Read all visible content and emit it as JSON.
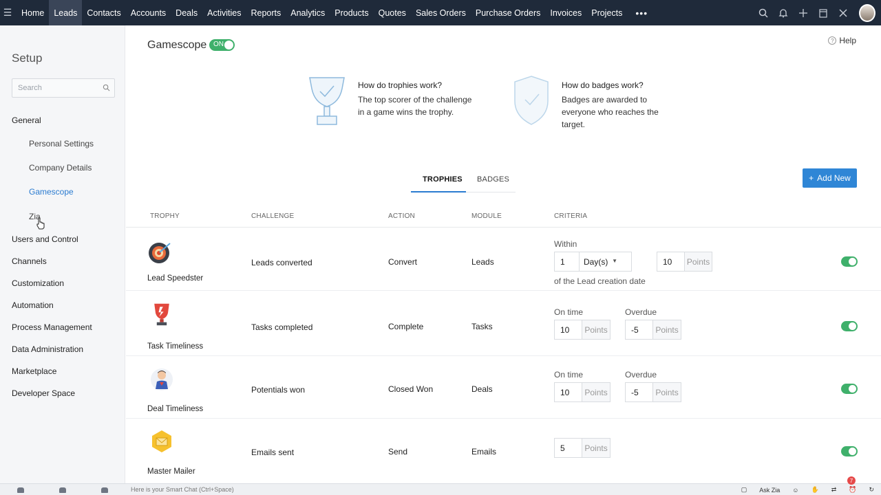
{
  "nav": {
    "items": [
      "Home",
      "Leads",
      "Contacts",
      "Accounts",
      "Deals",
      "Activities",
      "Reports",
      "Analytics",
      "Products",
      "Quotes",
      "Sales Orders",
      "Purchase Orders",
      "Invoices",
      "Projects"
    ],
    "active": "Leads",
    "more": "•••",
    "right_icons": [
      "search-icon",
      "bell-icon",
      "plus-icon",
      "calendar-icon",
      "tools-icon",
      "user-avatar"
    ]
  },
  "sidebar": {
    "title": "Setup",
    "search_placeholder": "Search",
    "sections": [
      {
        "label": "General",
        "children": [
          "Personal Settings",
          "Company Details",
          "Gamescope",
          "Zia"
        ]
      },
      {
        "label": "Users and Control"
      },
      {
        "label": "Channels"
      },
      {
        "label": "Customization"
      },
      {
        "label": "Automation"
      },
      {
        "label": "Process Management"
      },
      {
        "label": "Data Administration"
      },
      {
        "label": "Marketplace"
      },
      {
        "label": "Developer Space"
      }
    ],
    "active_child": "Gamescope"
  },
  "main": {
    "title": "Gamescope",
    "toggle_label": "ON",
    "help": "Help",
    "info": [
      {
        "heading": "How do trophies work?",
        "lines": [
          "The top scorer of the challenge",
          "in a game wins the trophy."
        ]
      },
      {
        "heading": "How do badges work?",
        "lines": [
          "Badges are awarded to",
          "everyone who reaches the",
          "target."
        ]
      }
    ],
    "tabs": [
      "TROPHIES",
      "BADGES"
    ],
    "active_tab": "TROPHIES",
    "add_new": "Add New",
    "columns": [
      "TROPHY",
      "CHALLENGE",
      "ACTION",
      "MODULE",
      "CRITERIA"
    ],
    "rows": [
      {
        "trophy": "Lead Speedster",
        "challenge": "Leads converted",
        "action": "Convert",
        "module": "Leads",
        "within_label": "Within",
        "within_value": "1",
        "within_unit": "Day(s)",
        "points": "10",
        "points_unit": "Points",
        "footer": "of the Lead creation date",
        "enabled": true
      },
      {
        "trophy": "Task Timeliness",
        "challenge": "Tasks completed",
        "action": "Complete",
        "module": "Tasks",
        "on_time_label": "On time",
        "on_time_points": "10",
        "overdue_label": "Overdue",
        "overdue_points": "-5",
        "points_unit": "Points",
        "enabled": true
      },
      {
        "trophy": "Deal Timeliness",
        "challenge": "Potentials won",
        "action": "Closed Won",
        "module": "Deals",
        "on_time_label": "On time",
        "on_time_points": "10",
        "overdue_label": "Overdue",
        "overdue_points": "-5",
        "points_unit": "Points",
        "enabled": true
      },
      {
        "trophy": "Master Mailer",
        "challenge": "Emails sent",
        "action": "Send",
        "module": "Emails",
        "points": "5",
        "points_unit": "Points",
        "enabled": true
      }
    ]
  },
  "bottombar": {
    "chat_placeholder": "Here is your Smart Chat (Ctrl+Space)",
    "ask_zia": "Ask Zia",
    "notification_count": "7"
  }
}
